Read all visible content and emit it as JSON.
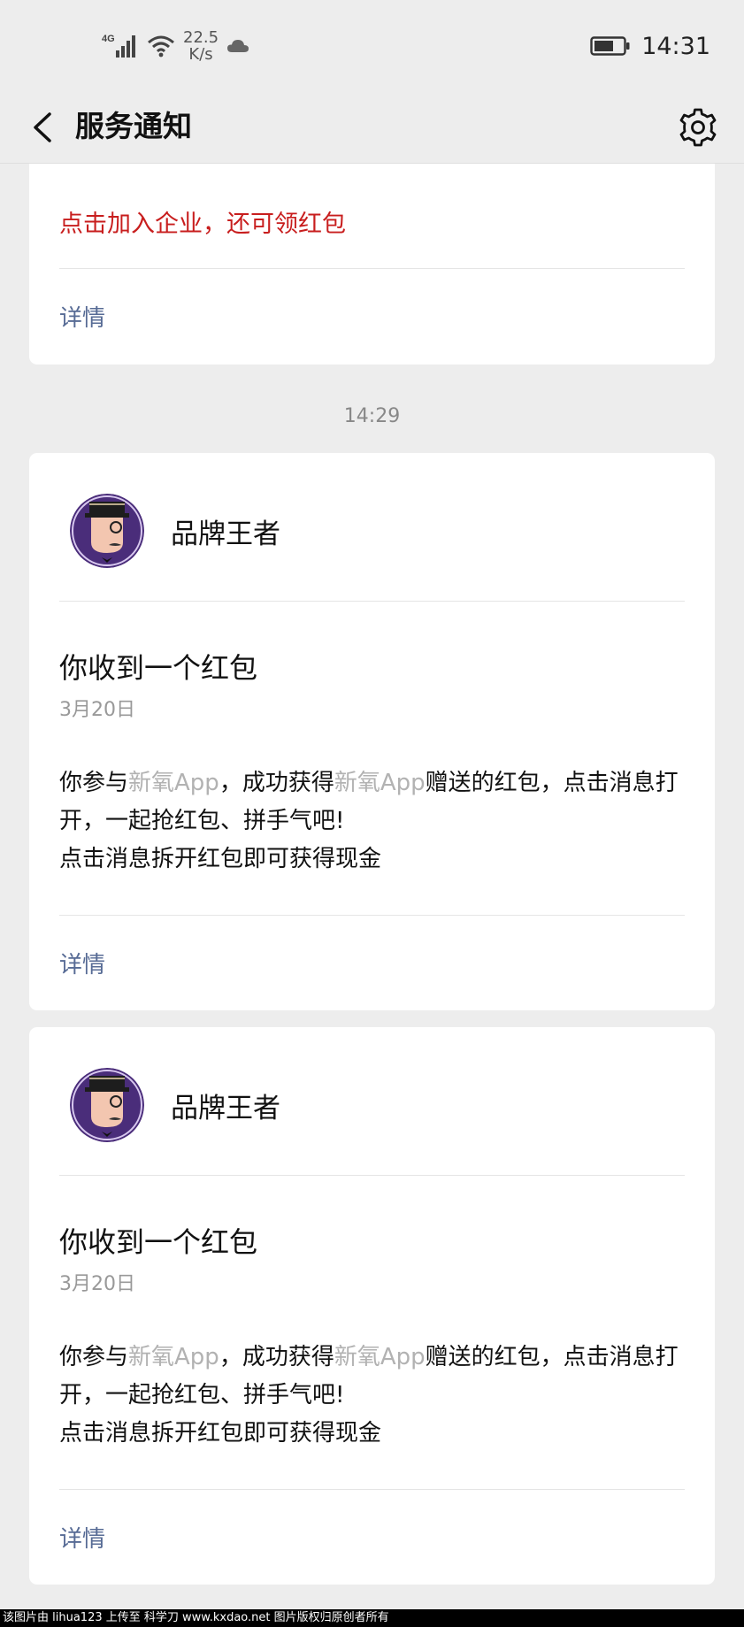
{
  "status_bar": {
    "network": "4G",
    "speed_value": "22.5",
    "speed_unit": "K/s",
    "time": "14:31",
    "icons": [
      "signal-icon",
      "wifi-icon",
      "cloud-icon",
      "battery-icon"
    ]
  },
  "nav": {
    "title": "服务通知",
    "back_icon": "chevron-left-icon",
    "settings_icon": "gear-icon"
  },
  "partial_card": {
    "text": "点击加入企业，还可领红包",
    "detail_label": "详情"
  },
  "timestamp": "14:29",
  "messages": [
    {
      "brand": "品牌王者",
      "title": "你收到一个红包",
      "date": "3月20日",
      "body_1": "你参与",
      "app_1": "新氧App",
      "body_2": "，成功获得",
      "app_2": "新氧App",
      "body_3": "赠送的红包，点击消息打开，一起抢红包、拼手气吧!",
      "body_line_2": "点击消息拆开红包即可获得现金",
      "detail_label": "详情"
    },
    {
      "brand": "品牌王者",
      "title": "你收到一个红包",
      "date": "3月20日",
      "body_1": "你参与",
      "app_1": "新氧App",
      "body_2": "，成功获得",
      "app_2": "新氧App",
      "body_3": "赠送的红包，点击消息打开，一起抢红包、拼手气吧!",
      "body_line_2": "点击消息拆开红包即可获得现金",
      "detail_label": "详情"
    }
  ],
  "watermark": "该图片由 lihua123 上传至 科学刀 www.kxdao.net 图片版权归原创者所有",
  "colors": {
    "background": "#ededed",
    "card": "#ffffff",
    "red_text": "#c81e1e",
    "link": "#576b95",
    "muted": "#999999",
    "app_name": "#b2b2b2"
  }
}
